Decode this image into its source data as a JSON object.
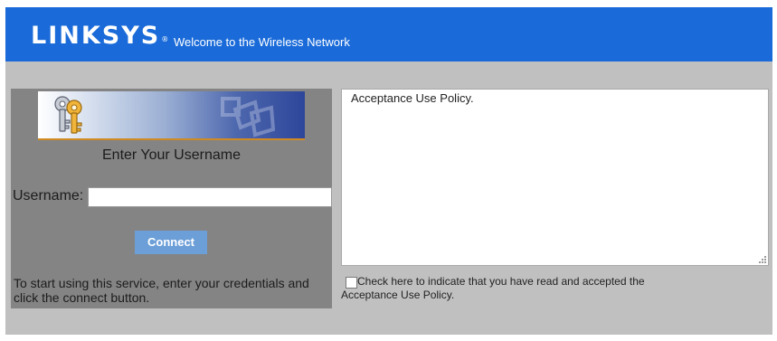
{
  "header": {
    "brand": "LINKSYS",
    "trademark": "®",
    "welcome": "Welcome to the Wireless Network",
    "background_color": "#1a6bd9"
  },
  "login": {
    "banner_icons": [
      "keys-icon",
      "network-shape-icon"
    ],
    "title": "Enter Your Username",
    "username_label": "Username:",
    "username_value": "",
    "connect_label": "Connect",
    "instructions": "To start using this service, enter your credentials and click the connect button.",
    "panel_color": "#848484",
    "button_color": "#6c9fd8"
  },
  "policy": {
    "text": "Acceptance Use Policy.",
    "checkbox_checked": false,
    "accept_label": "Check here to indicate that you have read and accepted the Acceptance Use Policy."
  }
}
